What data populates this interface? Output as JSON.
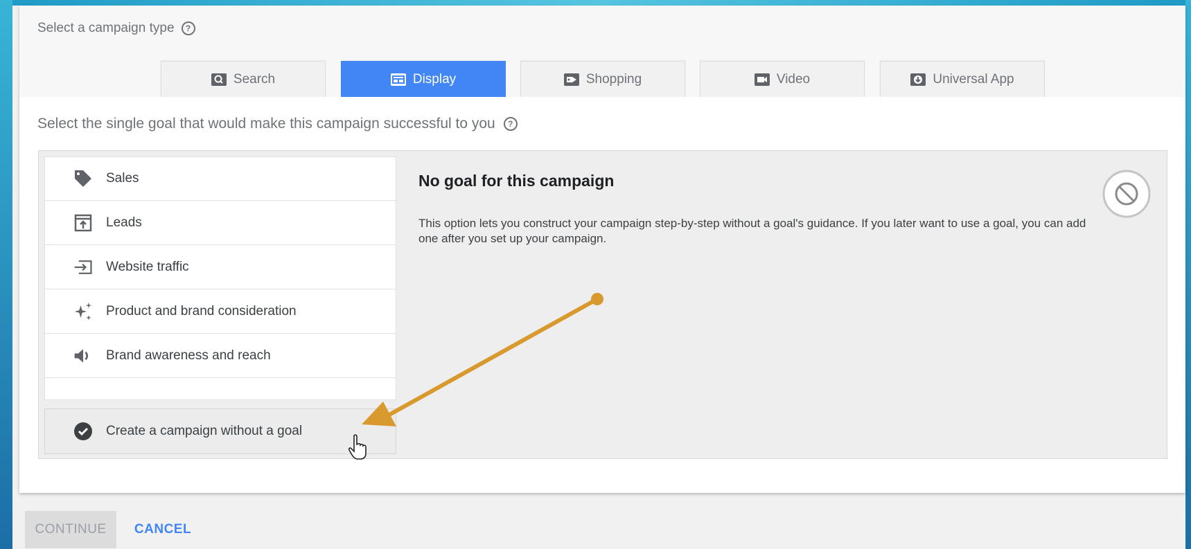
{
  "campaign_type": {
    "header": "Select a campaign type",
    "help_icon": "help-circle-icon",
    "tabs": [
      {
        "label": "Search",
        "icon": "search-icon",
        "active": false
      },
      {
        "label": "Display",
        "icon": "display-icon",
        "active": true
      },
      {
        "label": "Shopping",
        "icon": "tag-icon",
        "active": false
      },
      {
        "label": "Video",
        "icon": "video-icon",
        "active": false
      },
      {
        "label": "Universal App",
        "icon": "download-icon",
        "active": false
      }
    ]
  },
  "goal": {
    "header": "Select the single goal that would make this campaign successful to you",
    "items": [
      {
        "label": "Sales",
        "icon": "tag-icon"
      },
      {
        "label": "Leads",
        "icon": "upload-box-icon"
      },
      {
        "label": "Website traffic",
        "icon": "enter-arrow-icon"
      },
      {
        "label": "Product and brand consideration",
        "icon": "sparkle-icon"
      },
      {
        "label": "Brand awareness and reach",
        "icon": "speaker-icon"
      }
    ],
    "selected_option": {
      "label": "Create a campaign without a goal",
      "icon": "check-circle-icon"
    },
    "detail": {
      "title": "No goal for this campaign",
      "description": "This option lets you construct your campaign step-by-step without a goal's guidance. If you later want to use a goal, you can add one after you set up your campaign.",
      "icon": "block-icon"
    }
  },
  "actions": {
    "continue_label": "CONTINUE",
    "cancel_label": "CANCEL"
  },
  "colors": {
    "accent": "#4285f4",
    "annotation_arrow": "#d89a2e",
    "frame": "#2aa7cf"
  }
}
